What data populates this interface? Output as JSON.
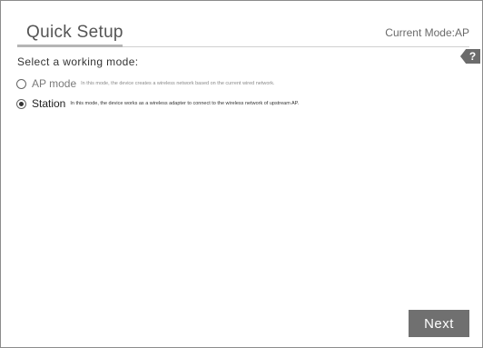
{
  "header": {
    "title": "Quick Setup",
    "current_mode": "Current Mode:AP"
  },
  "help": {
    "icon": "help-icon",
    "glyph": "?"
  },
  "prompt": "Select a working mode:",
  "options": [
    {
      "label": "AP mode",
      "description": "In this mode, the device creates a wireless network based on the current wired network.",
      "selected": false
    },
    {
      "label": "Station",
      "description": "In this mode, the device works as a wireless adapter to connect to the wireless network of upstream AP.",
      "selected": true
    }
  ],
  "footer": {
    "next_label": "Next"
  },
  "colors": {
    "button_bg": "#707070",
    "button_text": "#ffffff",
    "title_text": "#555555"
  }
}
